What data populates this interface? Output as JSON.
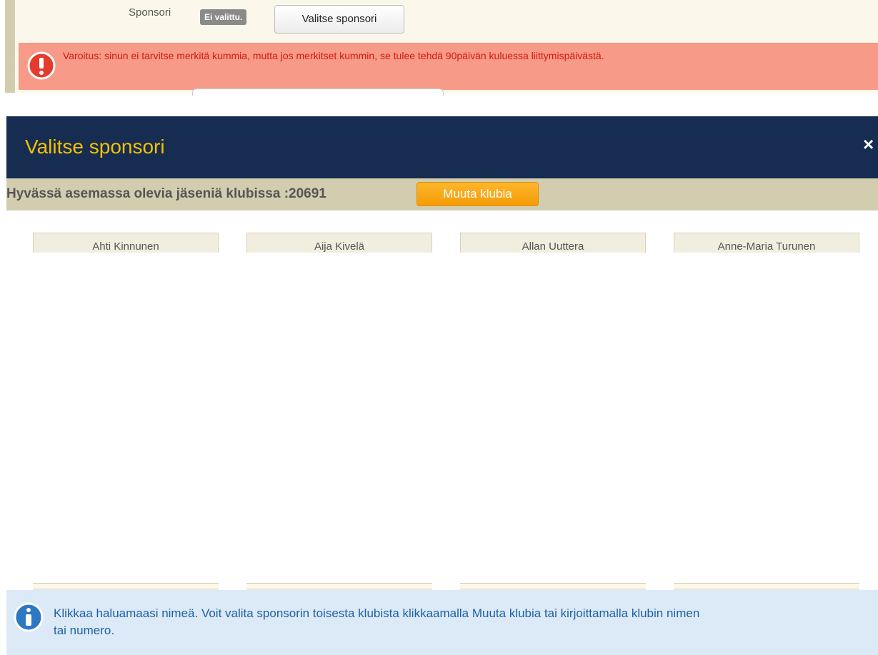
{
  "form": {
    "sponsor_label": "Sponsori",
    "status_chip": "Ei valittu.",
    "choose_button": "Valitse sponsori",
    "warning_text": "Varoitus: sinun ei tarvitse merkitä kummia, mutta jos merkitset kummin, se tulee tehdä 90päivän kuluessa liittymispäivästä."
  },
  "dialog": {
    "title": "Valitse sponsori",
    "close_glyph": "×",
    "club_status": "Hyvässä asemassa olevia jäseniä klubissa :20691",
    "change_club_button": "Muuta klubia",
    "members": [
      "Ahti Kinnunen",
      "Aija Kivelä",
      "Allan Uuttera",
      "Anne-Maria Turunen"
    ],
    "info_line1": "Klikkaa haluamaasi nimeä. Voit valita sponsorin toisesta klubista klikkaamalla Muuta klubia tai kirjoittamalla klubin nimen",
    "info_line2": "tai numero."
  },
  "colors": {
    "header_bg": "#162c50",
    "title_accent": "#f3c100",
    "club_bar_bg": "#d3cdb0",
    "button_orange": "#f49c06",
    "warning_bg": "#f79a88",
    "warning_text": "#d11b12",
    "info_bg": "#dbeaf6",
    "info_text": "#1f5fa5"
  },
  "icons": {
    "warning": "exclamation-circle-icon",
    "info": "info-circle-icon",
    "close": "close-icon"
  }
}
